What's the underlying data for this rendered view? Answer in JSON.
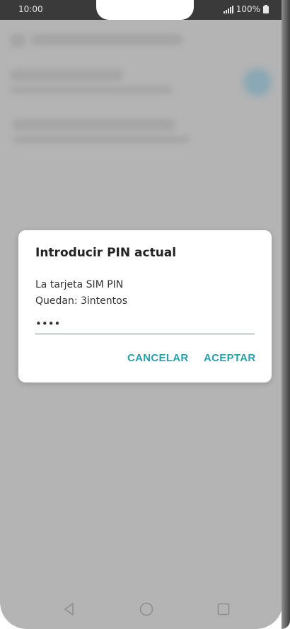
{
  "status_bar": {
    "time": "10:00",
    "battery": "100%",
    "icons": [
      "signal-icon",
      "battery-icon"
    ]
  },
  "dialog": {
    "title": "Introducir PIN actual",
    "message_line1": "La tarjeta SIM PIN",
    "message_line2": "Quedan: 3intentos",
    "pin_value": "••••",
    "cancel_label": "CANCELAR",
    "ok_label": "ACEPTAR"
  },
  "nav_bar": {
    "icons": [
      "back-icon",
      "home-icon",
      "recent-apps-icon"
    ]
  },
  "colors": {
    "accent": "#2a9fae",
    "overlay": "#b4b4b4",
    "status_bar": "#3a3a3a"
  }
}
